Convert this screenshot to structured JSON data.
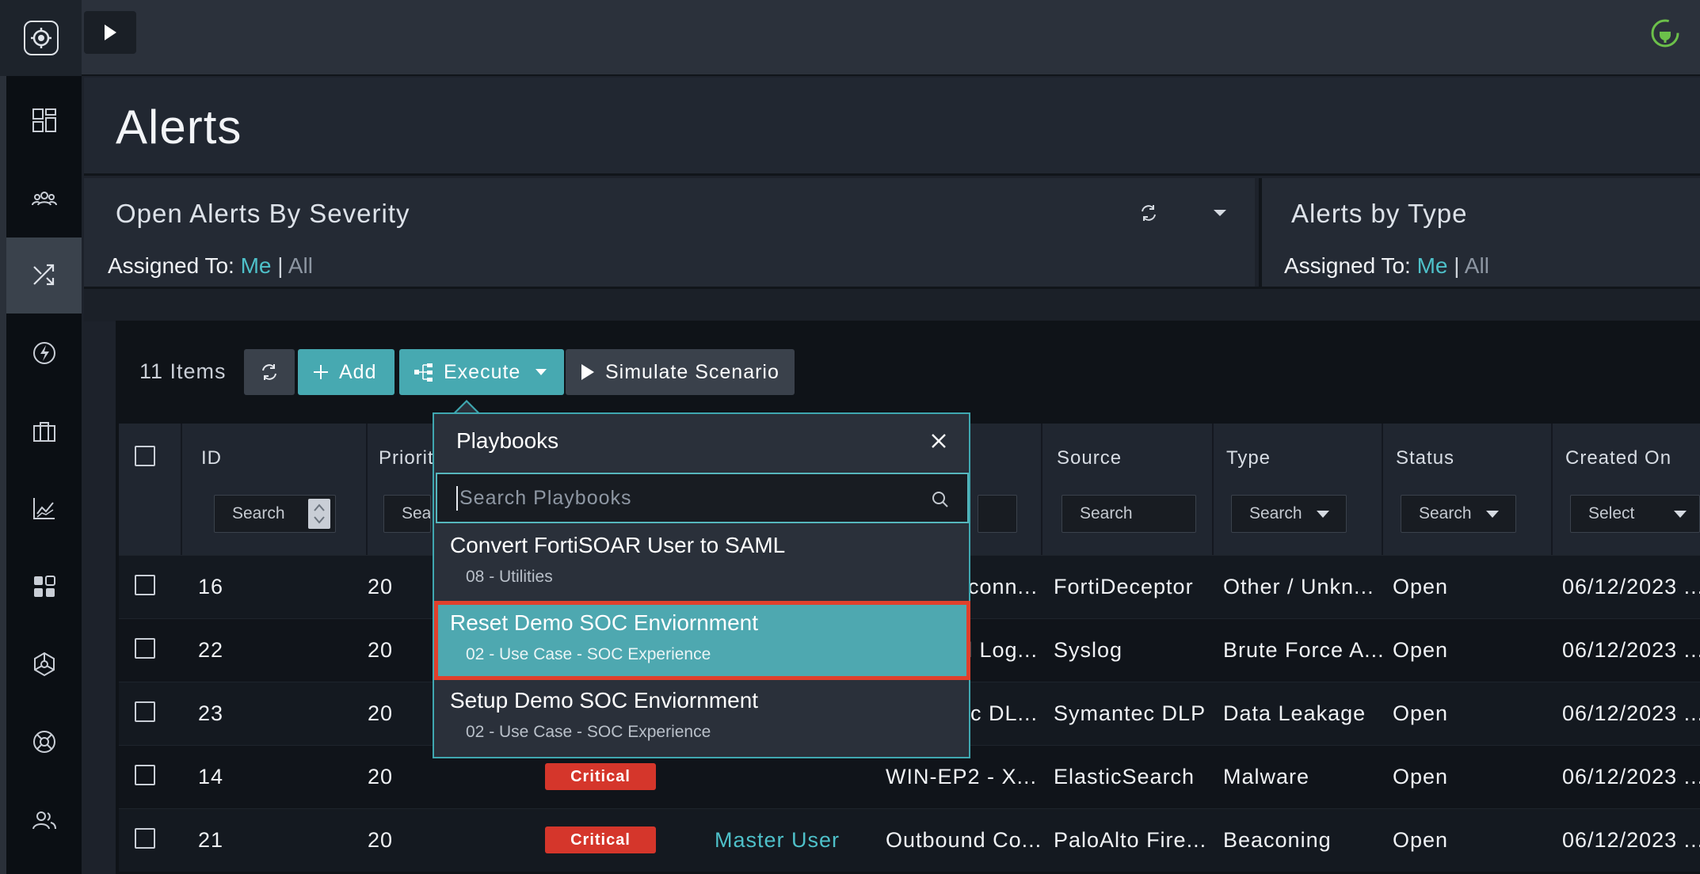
{
  "colors": {
    "accent": "#47a9b1",
    "link": "#4ec0c9",
    "critical": "#d5362b",
    "highlight_border": "#e0402c"
  },
  "rail": {
    "icons": [
      "logo-icon",
      "dashboard-icon",
      "teams-icon",
      "shuffle-icon",
      "lightning-icon",
      "briefcase-icon",
      "chart-icon",
      "apps-icon",
      "network-icon",
      "help-icon",
      "users-icon"
    ]
  },
  "topbar": {
    "toggle_icon": "play-icon",
    "status_icon": "plug-icon"
  },
  "page": {
    "title": "Alerts"
  },
  "widgets": [
    {
      "title": "Open Alerts By Severity",
      "assigned_label": "Assigned To:",
      "me": "Me",
      "sep": "|",
      "all": "All"
    },
    {
      "title": "Alerts by Type",
      "assigned_label": "Assigned To:",
      "me": "Me",
      "sep": "|",
      "all": "All"
    }
  ],
  "toolbar": {
    "count": "11 Items",
    "add": "Add",
    "execute": "Execute",
    "simulate": "Simulate Scenario"
  },
  "grid": {
    "columns": {
      "id": "ID",
      "priority": "Priorit",
      "source": "Source",
      "type": "Type",
      "status": "Status",
      "created": "Created On"
    },
    "filters": {
      "id": "Search",
      "priority": "Sear",
      "source": "Search",
      "type": "Search",
      "status": "Search",
      "created": "Select"
    },
    "rows": [
      {
        "id": "16",
        "priority": "20",
        "severity": "",
        "assigned": "",
        "name": "conn...",
        "source": "FortiDeceptor",
        "type": "Other / Unkn...",
        "status": "Open",
        "created": "06/12/2023 ..."
      },
      {
        "id": "22",
        "priority": "20",
        "severity": "",
        "assigned": "",
        "name": "l Log...",
        "source": "Syslog",
        "type": "Brute Force A...",
        "status": "Open",
        "created": "06/12/2023 ..."
      },
      {
        "id": "23",
        "priority": "20",
        "severity": "",
        "assigned": "",
        "name": "c DL...",
        "source": "Symantec DLP",
        "type": "Data Leakage",
        "status": "Open",
        "created": "06/12/2023 ..."
      },
      {
        "id": "14",
        "priority": "20",
        "severity": "Critical",
        "assigned": "",
        "name": "WIN-EP2 - X...",
        "source": "ElasticSearch",
        "type": "Malware",
        "status": "Open",
        "created": "06/12/2023 ..."
      },
      {
        "id": "21",
        "priority": "20",
        "severity": "Critical",
        "assigned": "Master User",
        "name": "Outbound Co...",
        "source": "PaloAlto Fire...",
        "type": "Beaconing",
        "status": "Open",
        "created": "06/12/2023 ..."
      }
    ]
  },
  "playbooks": {
    "title": "Playbooks",
    "search_placeholder": "Search Playbooks",
    "items": [
      {
        "name": "Convert FortiSOAR User to SAML",
        "category": "08 - Utilities"
      },
      {
        "name": "Reset Demo SOC Enviornment",
        "category": "02 - Use Case - SOC Experience"
      },
      {
        "name": "Setup Demo SOC Enviornment",
        "category": "02 - Use Case - SOC Experience"
      }
    ],
    "selected_index": 1
  }
}
